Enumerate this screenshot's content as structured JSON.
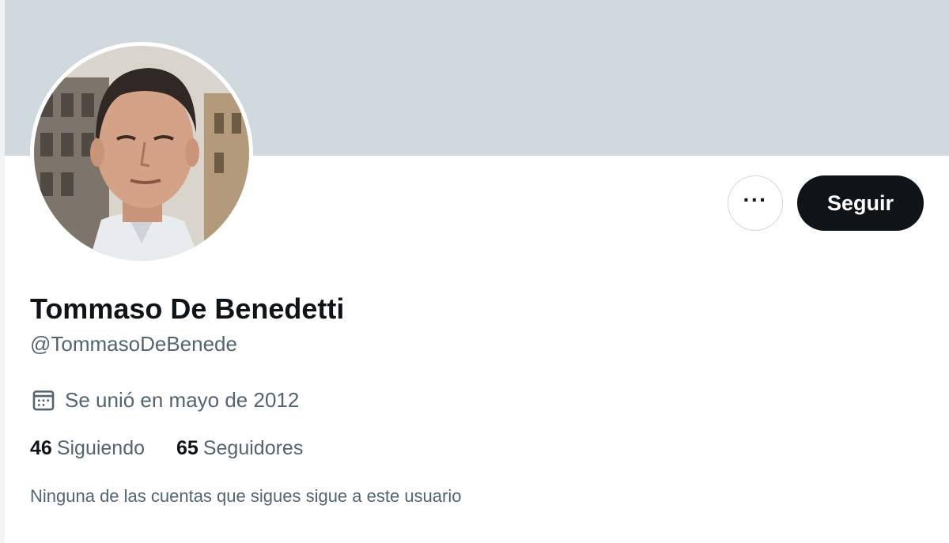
{
  "profile": {
    "display_name": "Tommaso De Benedetti",
    "handle": "@TommasoDeBenede",
    "joined": "Se unió en mayo de 2012",
    "follow_label": "Seguir",
    "more_label": "···",
    "stats": {
      "following_count": "46",
      "following_label": "Siguiendo",
      "followers_count": "65",
      "followers_label": "Seguidores"
    },
    "followers_note": "Ninguna de las cuentas que sigues sigue a este usuario"
  },
  "colors": {
    "banner": "#cfd9de",
    "text_primary": "#0f1419",
    "text_secondary": "#536471",
    "button_dark": "#0f1419"
  },
  "icons": {
    "joined_icon": "calendar-icon",
    "more_icon": "more-horizontal-icon"
  }
}
